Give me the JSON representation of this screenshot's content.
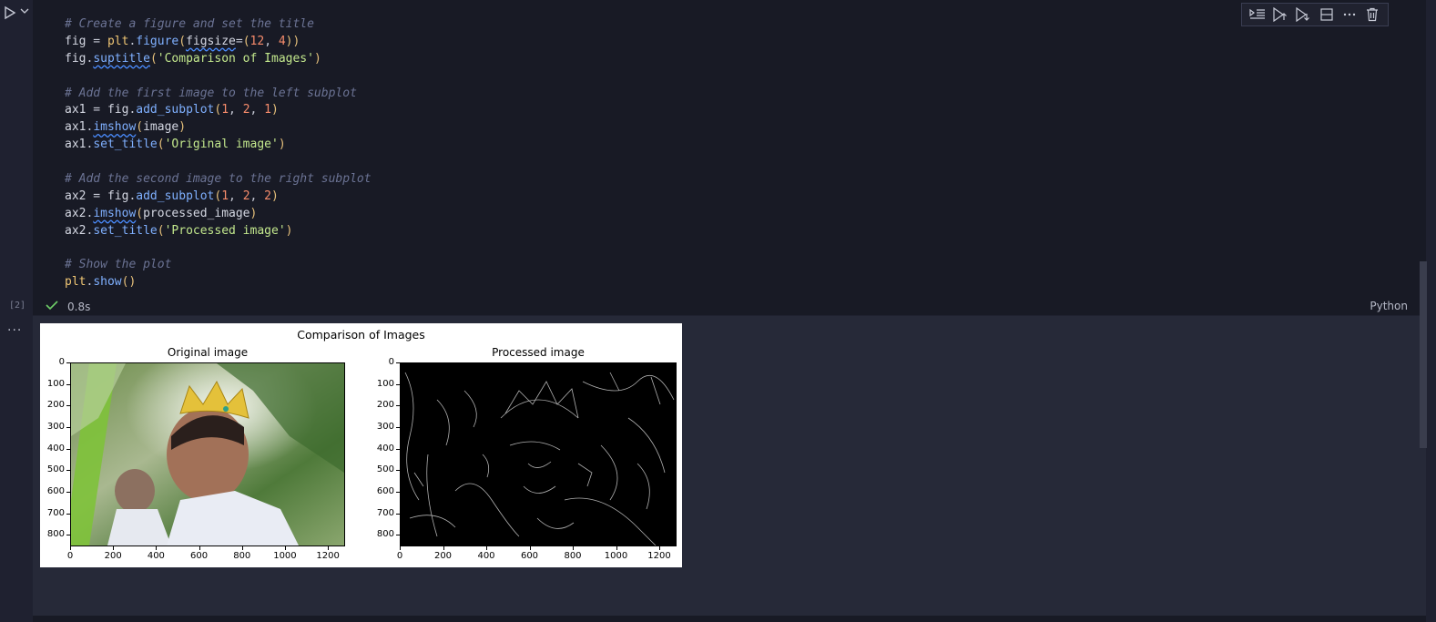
{
  "cell": {
    "execution_count": "[2]",
    "status_timing": "0.8s",
    "language": "Python",
    "output_menu": "···",
    "code_lines": [
      [
        {
          "t": "# Create a figure and set the title",
          "c": "comment"
        }
      ],
      [
        {
          "t": "fig",
          "c": "var"
        },
        {
          "t": " = ",
          "c": "op"
        },
        {
          "t": "plt",
          "c": "obj"
        },
        {
          "t": ".",
          "c": "op"
        },
        {
          "t": "figure",
          "c": "func"
        },
        {
          "t": "(",
          "c": "paren"
        },
        {
          "t": "figsize",
          "c": "var",
          "sq": true
        },
        {
          "t": "=",
          "c": "op"
        },
        {
          "t": "(",
          "c": "paren"
        },
        {
          "t": "12",
          "c": "num"
        },
        {
          "t": ", ",
          "c": "op"
        },
        {
          "t": "4",
          "c": "num"
        },
        {
          "t": "))",
          "c": "paren"
        }
      ],
      [
        {
          "t": "fig",
          "c": "var"
        },
        {
          "t": ".",
          "c": "op"
        },
        {
          "t": "suptitle",
          "c": "func",
          "sq": true
        },
        {
          "t": "(",
          "c": "paren"
        },
        {
          "t": "'Comparison of Images'",
          "c": "str"
        },
        {
          "t": ")",
          "c": "paren"
        }
      ],
      [],
      [
        {
          "t": "# Add the first image to the left subplot",
          "c": "comment"
        }
      ],
      [
        {
          "t": "ax1",
          "c": "var"
        },
        {
          "t": " = ",
          "c": "op"
        },
        {
          "t": "fig",
          "c": "var"
        },
        {
          "t": ".",
          "c": "op"
        },
        {
          "t": "add_subplot",
          "c": "func"
        },
        {
          "t": "(",
          "c": "paren"
        },
        {
          "t": "1",
          "c": "num"
        },
        {
          "t": ", ",
          "c": "op"
        },
        {
          "t": "2",
          "c": "num"
        },
        {
          "t": ", ",
          "c": "op"
        },
        {
          "t": "1",
          "c": "num"
        },
        {
          "t": ")",
          "c": "paren"
        }
      ],
      [
        {
          "t": "ax1",
          "c": "var"
        },
        {
          "t": ".",
          "c": "op"
        },
        {
          "t": "imshow",
          "c": "func",
          "sq": true
        },
        {
          "t": "(",
          "c": "paren"
        },
        {
          "t": "image",
          "c": "var"
        },
        {
          "t": ")",
          "c": "paren"
        }
      ],
      [
        {
          "t": "ax1",
          "c": "var"
        },
        {
          "t": ".",
          "c": "op"
        },
        {
          "t": "set_title",
          "c": "func"
        },
        {
          "t": "(",
          "c": "paren"
        },
        {
          "t": "'Original image'",
          "c": "str"
        },
        {
          "t": ")",
          "c": "paren"
        }
      ],
      [],
      [
        {
          "t": "# Add the second image to the right subplot",
          "c": "comment"
        }
      ],
      [
        {
          "t": "ax2",
          "c": "var"
        },
        {
          "t": " = ",
          "c": "op"
        },
        {
          "t": "fig",
          "c": "var"
        },
        {
          "t": ".",
          "c": "op"
        },
        {
          "t": "add_subplot",
          "c": "func"
        },
        {
          "t": "(",
          "c": "paren"
        },
        {
          "t": "1",
          "c": "num"
        },
        {
          "t": ", ",
          "c": "op"
        },
        {
          "t": "2",
          "c": "num"
        },
        {
          "t": ", ",
          "c": "op"
        },
        {
          "t": "2",
          "c": "num"
        },
        {
          "t": ")",
          "c": "paren"
        }
      ],
      [
        {
          "t": "ax2",
          "c": "var"
        },
        {
          "t": ".",
          "c": "op"
        },
        {
          "t": "imshow",
          "c": "func",
          "sq": true
        },
        {
          "t": "(",
          "c": "paren"
        },
        {
          "t": "processed_image",
          "c": "var"
        },
        {
          "t": ")",
          "c": "paren"
        }
      ],
      [
        {
          "t": "ax2",
          "c": "var"
        },
        {
          "t": ".",
          "c": "op"
        },
        {
          "t": "set_title",
          "c": "func"
        },
        {
          "t": "(",
          "c": "paren"
        },
        {
          "t": "'Processed image'",
          "c": "str"
        },
        {
          "t": ")",
          "c": "paren"
        }
      ],
      [],
      [
        {
          "t": "# Show the plot",
          "c": "comment"
        }
      ],
      [
        {
          "t": "plt",
          "c": "obj"
        },
        {
          "t": ".",
          "c": "op"
        },
        {
          "t": "show",
          "c": "func"
        },
        {
          "t": "()",
          "c": "paren"
        }
      ]
    ]
  },
  "toolbar": {
    "buttons": [
      "run-by-line-icon",
      "execute-above-icon",
      "execute-below-icon",
      "split-cell-icon",
      "more-actions-icon",
      "delete-cell-icon"
    ]
  },
  "figure": {
    "suptitle": "Comparison of Images",
    "left_title": "Original image",
    "right_title": "Processed image",
    "y_ticks": [
      "0",
      "100",
      "200",
      "300",
      "400",
      "500",
      "600",
      "700",
      "800"
    ],
    "x_ticks": [
      "0",
      "200",
      "400",
      "600",
      "800",
      "1000",
      "1200"
    ]
  },
  "colors": {
    "editor_bg": "#181a25",
    "output_bg": "#262938",
    "check": "#6ecf68"
  }
}
